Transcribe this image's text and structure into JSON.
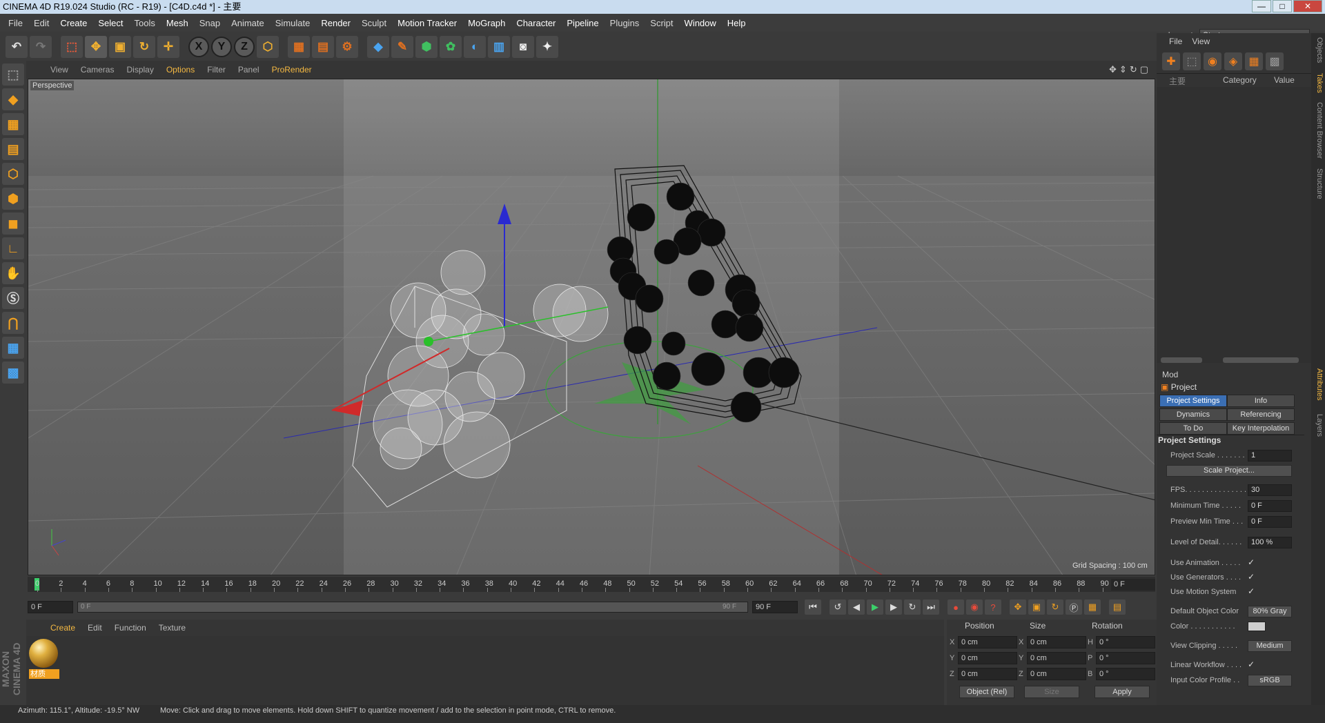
{
  "titlebar": {
    "title": "CINEMA 4D R19.024 Studio (RC - R19) - [C4D.c4d *] - 主要"
  },
  "menu": [
    "File",
    "Edit",
    "Create",
    "Select",
    "Tools",
    "Mesh",
    "Snap",
    "Animate",
    "Simulate",
    "Render",
    "Sculpt",
    "Motion Tracker",
    "MoGraph",
    "Character",
    "Pipeline",
    "Plugins",
    "Script",
    "Window",
    "Help"
  ],
  "layout": {
    "label": "Layout:",
    "value": "Startup"
  },
  "toolbar": {
    "icons": [
      "undo-icon",
      "redo-icon",
      "live-selection-icon",
      "move-icon",
      "scale-icon",
      "rotate-icon",
      "recent-tool-icon",
      "x-axis-lock-icon",
      "y-axis-lock-icon",
      "z-axis-lock-icon",
      "coordinate-system-icon",
      "render-view-icon",
      "render-to-picture-viewer-icon",
      "render-settings-icon",
      "cube-icon",
      "pen-spline-icon",
      "subdivision-surface-icon",
      "cloner-icon",
      "deformer-icon",
      "floor-icon",
      "camera-icon",
      "light-icon"
    ],
    "axis_x": "X",
    "axis_y": "Y",
    "axis_z": "Z"
  },
  "view_menu": {
    "items": [
      "View",
      "Cameras",
      "Display",
      "Options",
      "Filter",
      "Panel",
      "ProRender"
    ]
  },
  "viewport": {
    "label": "Perspective",
    "grid_spacing": "Grid Spacing : 100 cm"
  },
  "timeline": {
    "ticks": [
      "0",
      "2",
      "4",
      "6",
      "8",
      "10",
      "12",
      "14",
      "16",
      "18",
      "20",
      "22",
      "24",
      "26",
      "28",
      "30",
      "32",
      "34",
      "36",
      "38",
      "40",
      "42",
      "44",
      "46",
      "48",
      "50",
      "52",
      "54",
      "56",
      "58",
      "60",
      "62",
      "64",
      "66",
      "68",
      "70",
      "72",
      "74",
      "76",
      "78",
      "80",
      "82",
      "84",
      "86",
      "88",
      "90"
    ],
    "current_frame": "0 F"
  },
  "transport": {
    "start": "0 F",
    "slider_start": "0 F",
    "slider_end": "90 F",
    "end": "90 F"
  },
  "material_manager": {
    "menu": [
      "Create",
      "Edit",
      "Function",
      "Texture"
    ],
    "material_name": "材质"
  },
  "coordinates": {
    "headers": {
      "position": "Position",
      "size": "Size",
      "rotation": "Rotation"
    },
    "rows": [
      {
        "axis": "X",
        "pos": "0 cm",
        "saxis": "X",
        "size": "0 cm",
        "raxis": "H",
        "rot": "0 °"
      },
      {
        "axis": "Y",
        "pos": "0 cm",
        "saxis": "Y",
        "size": "0 cm",
        "raxis": "P",
        "rot": "0 °"
      },
      {
        "axis": "Z",
        "pos": "0 cm",
        "saxis": "Z",
        "size": "0 cm",
        "raxis": "B",
        "rot": "0 °"
      }
    ],
    "mode": "Object (Rel)",
    "size_mode": "Size",
    "apply": "Apply"
  },
  "status": {
    "azimuth": "Azimuth: 115.1°, Altitude: -19.5°  NW",
    "message": "Move: Click and drag to move elements. Hold down SHIFT to quantize movement / add to the selection in point mode, CTRL to remove."
  },
  "object_manager": {
    "menu": [
      "File",
      "View"
    ],
    "col_name": "主要",
    "col_category": "Category",
    "col_value": "Value"
  },
  "attributes": {
    "mode": "Mod",
    "project": "Project",
    "tabs": [
      "Project Settings",
      "Info",
      "Dynamics",
      "Referencing",
      "To Do",
      "Key Interpolation"
    ],
    "section": "Project Settings",
    "rows": [
      {
        "label": "Project Scale . . . . . . .",
        "value": "1"
      },
      {
        "button": "Scale Project..."
      },
      {
        "label": "FPS. . . . . . . . . . . . . . .",
        "value": "30"
      },
      {
        "label": "Minimum Time . . . . .",
        "value": "0 F"
      },
      {
        "label": "Preview Min Time . . .",
        "value": "0 F"
      },
      {
        "label": "Level of Detail. . . . . .",
        "value": "100 %"
      },
      {
        "label": "Use Animation . . . . .",
        "check": "✓"
      },
      {
        "label": "Use Generators . . . .",
        "check": "✓"
      },
      {
        "label": "Use Motion System",
        "check": "✓"
      },
      {
        "label": "Default Object Color",
        "value": "80% Gray"
      },
      {
        "label": "Color . . . . . . . . . . .",
        "swatch": true
      },
      {
        "label": "View Clipping . . . . .",
        "value": "Medium"
      },
      {
        "label": "Linear Workflow . . . .",
        "check": "✓"
      },
      {
        "label": "Input Color Profile . .",
        "value": "sRGB"
      }
    ]
  },
  "right_tabs": [
    "Objects",
    "Takes",
    "Content Browser",
    "Structure",
    "Attributes",
    "Layers"
  ],
  "brand": "MAXON CINEMA 4D"
}
